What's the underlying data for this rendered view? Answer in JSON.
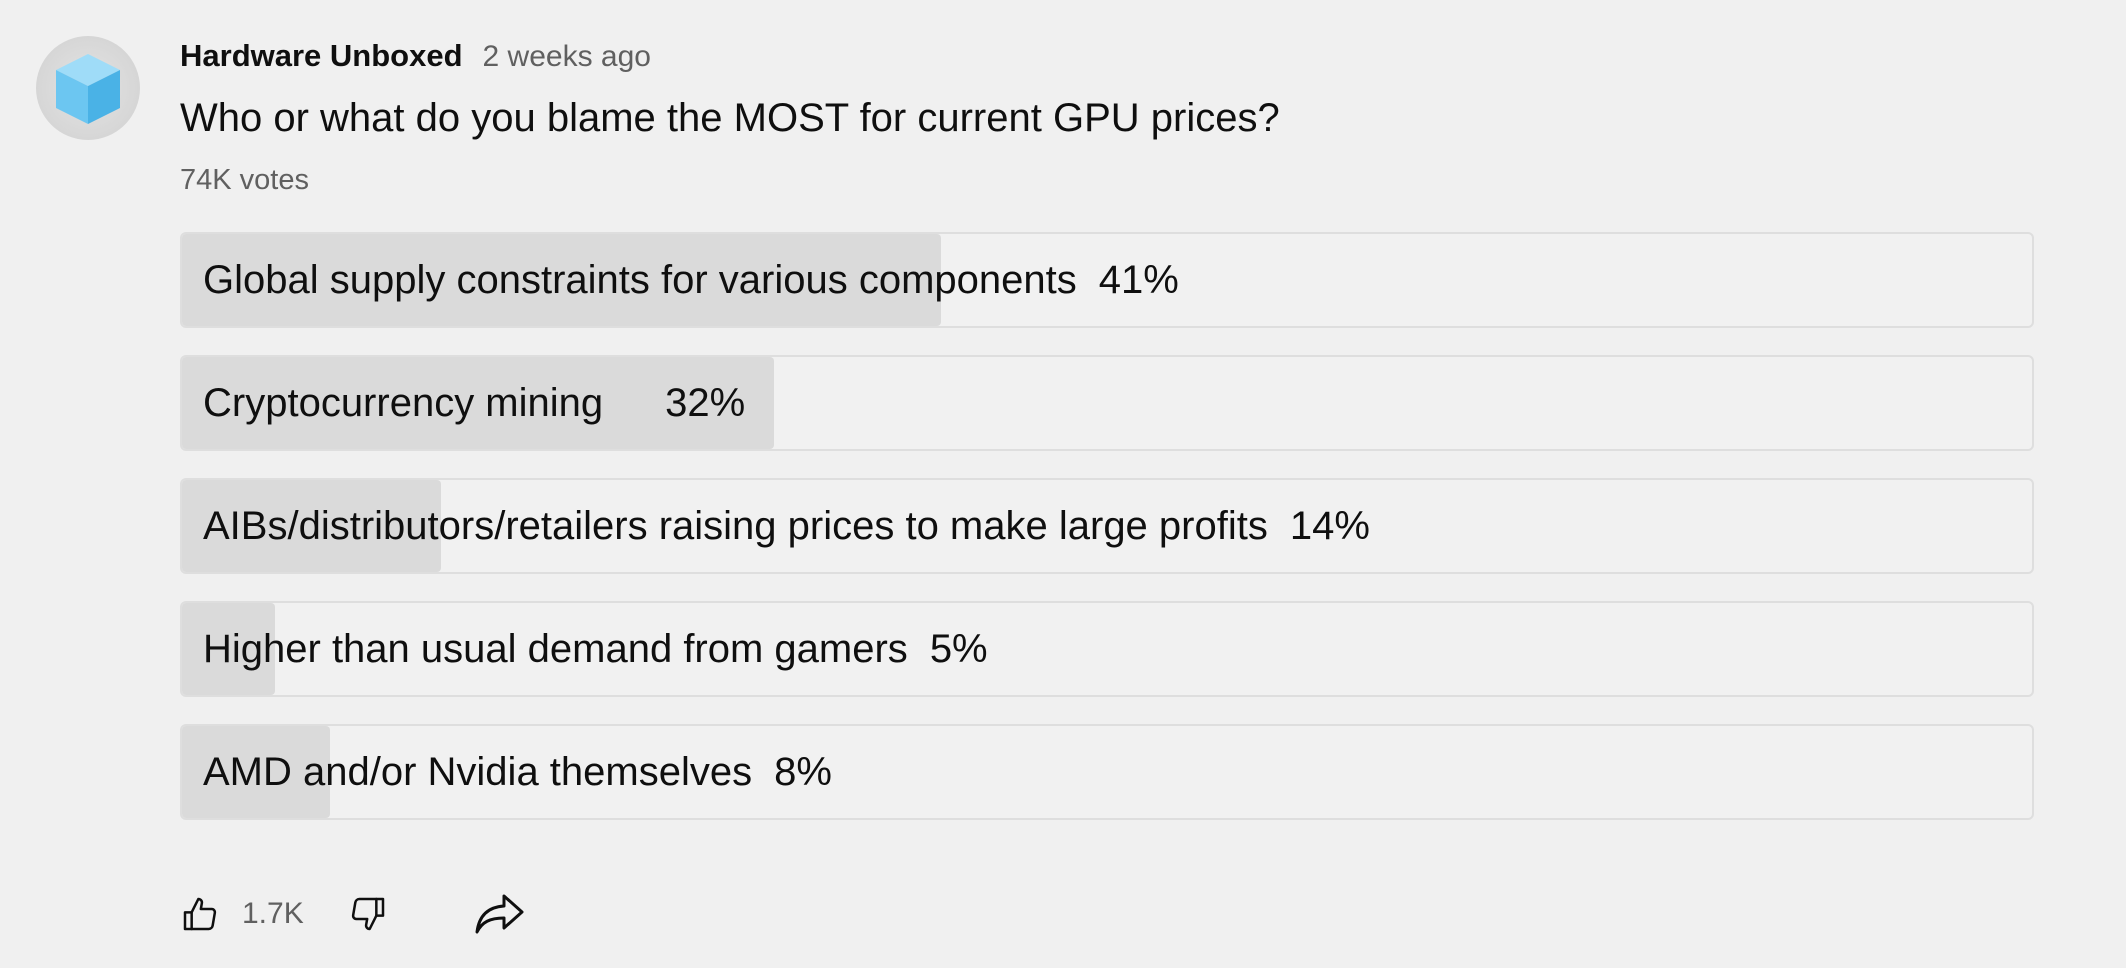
{
  "post": {
    "author": "Hardware Unboxed",
    "time": "2 weeks ago",
    "question": "Who or what do you blame the MOST for current GPU prices?",
    "votes": "74K votes"
  },
  "poll": {
    "options": [
      {
        "label": "Global supply constraints for various components",
        "percent_text": "41%",
        "percent": 41
      },
      {
        "label": "Cryptocurrency mining",
        "percent_text": "32%",
        "percent": 32
      },
      {
        "label": "AIBs/distributors/retailers raising prices to make large profits",
        "percent_text": "14%",
        "percent": 14
      },
      {
        "label": "Higher than usual demand from gamers",
        "percent_text": "5%",
        "percent": 5
      },
      {
        "label": "AMD and/or Nvidia themselves",
        "percent_text": "8%",
        "percent": 8
      }
    ]
  },
  "actions": {
    "like_count": "1.7K",
    "like_icon": "thumbs-up-icon",
    "dislike_icon": "thumbs-down-icon",
    "share_icon": "share-icon"
  },
  "colors": {
    "background": "#f0f0f0",
    "bar_fill": "#dadada",
    "text": "#0f0f0f",
    "secondary_text": "#606060",
    "avatar_cube": "#5fbfed"
  }
}
